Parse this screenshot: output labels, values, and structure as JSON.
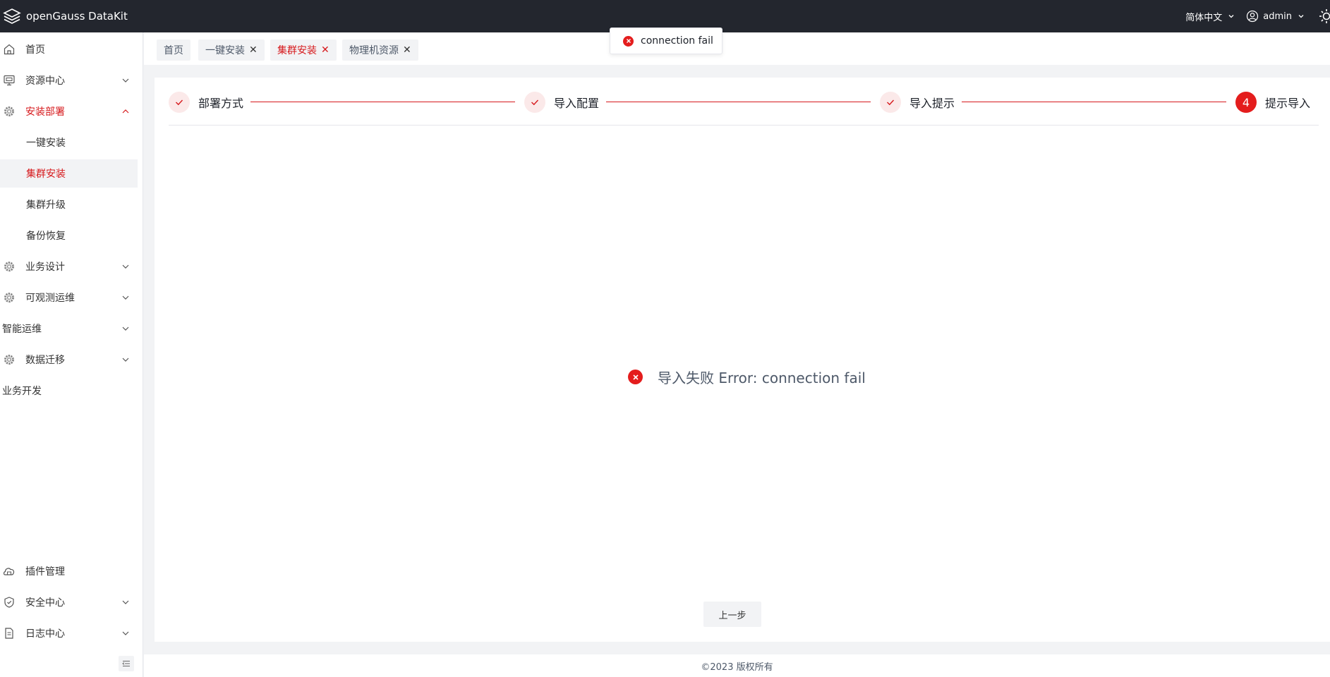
{
  "app": {
    "title": "openGauss DataKit",
    "language": "简体中文",
    "user": "admin",
    "accent_color": "#d6191c",
    "header_bg": "#23262e"
  },
  "sidebar": {
    "items": [
      {
        "label": "首页",
        "icon": "home-icon"
      },
      {
        "label": "资源中心",
        "icon": "monitor-icon"
      },
      {
        "label": "安装部署",
        "icon": "gear-icon"
      },
      {
        "label": "一键安装"
      },
      {
        "label": "集群安装"
      },
      {
        "label": "集群升级"
      },
      {
        "label": "备份恢复"
      },
      {
        "label": "业务设计",
        "icon": "gear-icon"
      },
      {
        "label": "可观测运维",
        "icon": "gear-icon"
      },
      {
        "label": "智能运维"
      },
      {
        "label": "数据迁移",
        "icon": "gear-icon"
      },
      {
        "label": "业务开发"
      },
      {
        "label": "插件管理",
        "icon": "plugin-icon"
      },
      {
        "label": "安全中心",
        "icon": "shield-icon"
      },
      {
        "label": "日志中心",
        "icon": "document-icon"
      }
    ]
  },
  "tabs": [
    {
      "label": "首页",
      "closable": false
    },
    {
      "label": "一键安装",
      "closable": true
    },
    {
      "label": "集群安装",
      "closable": true,
      "active": true
    },
    {
      "label": "物理机资源",
      "closable": true
    }
  ],
  "steps": [
    {
      "title": "部署方式",
      "status": "done"
    },
    {
      "title": "导入配置",
      "status": "done"
    },
    {
      "title": "导入提示",
      "status": "done"
    },
    {
      "title": "提示导入",
      "status": "current",
      "number": "4"
    }
  ],
  "result": {
    "message": "导入失败 Error: connection fail"
  },
  "buttons": {
    "prev": "上一步"
  },
  "toast": {
    "message": "connection fail"
  },
  "footer": {
    "copyright": "©2023 版权所有"
  }
}
